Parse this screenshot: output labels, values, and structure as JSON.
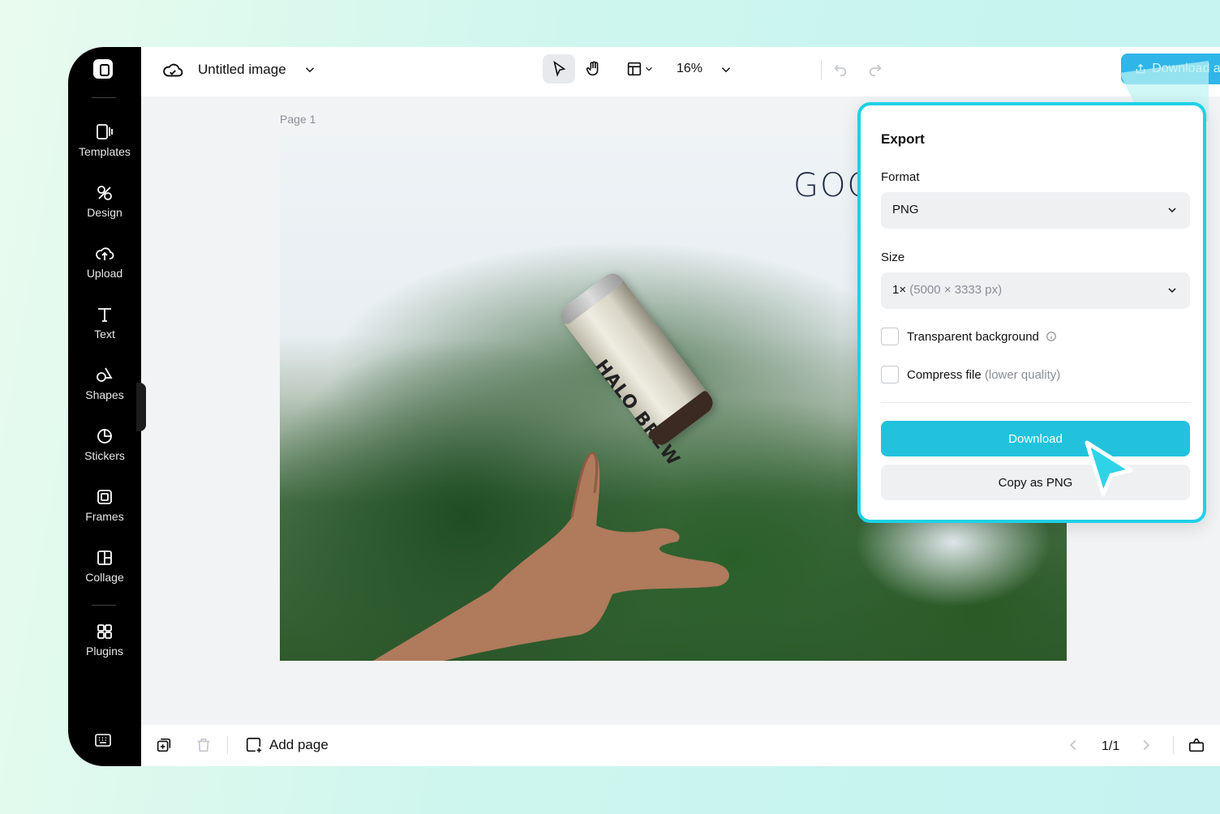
{
  "sidebar": {
    "items": [
      {
        "label": "Templates",
        "icon": "templates-icon"
      },
      {
        "label": "Design",
        "icon": "design-icon"
      },
      {
        "label": "Upload",
        "icon": "upload-cloud-icon"
      },
      {
        "label": "Text",
        "icon": "text-icon"
      },
      {
        "label": "Shapes",
        "icon": "shapes-icon"
      },
      {
        "label": "Stickers",
        "icon": "stickers-icon"
      },
      {
        "label": "Frames",
        "icon": "frames-icon"
      },
      {
        "label": "Collage",
        "icon": "collage-icon"
      },
      {
        "label": "Plugins",
        "icon": "plugins-icon"
      }
    ]
  },
  "topbar": {
    "doc_title": "Untitled image",
    "zoom": "16%",
    "download_all_label": "Download all"
  },
  "canvas": {
    "page_label": "Page 1",
    "headline_text": "GOO",
    "can_text": "HALO BREW"
  },
  "export_panel": {
    "title": "Export",
    "format_label": "Format",
    "format_value": "PNG",
    "size_label": "Size",
    "size_value": "1×",
    "size_detail": "(5000 × 3333 px)",
    "transparent_label": "Transparent background",
    "compress_label": "Compress file",
    "compress_hint": "(lower quality)",
    "download_label": "Download",
    "copy_label": "Copy as PNG"
  },
  "bottombar": {
    "add_page_label": "Add page",
    "page_indicator": "1/1"
  },
  "colors": {
    "accent": "#22c2dc",
    "download_all_bg": "#2fb5e8",
    "panel_border": "#1fd0e6",
    "sidebar_bg": "#000000"
  }
}
